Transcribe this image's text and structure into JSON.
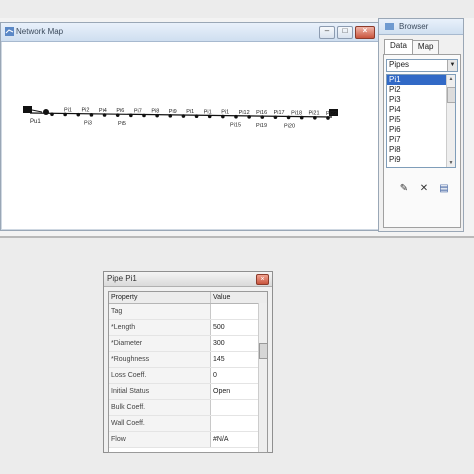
{
  "map_window": {
    "title": "Network Map",
    "buttons": {
      "minimize": "–",
      "maximize": "□",
      "close": "×"
    },
    "network": {
      "reservoir_label": "Pu1",
      "pipe_labels_top": [
        "Pi1",
        "Pi2",
        "Pi4",
        "Pi6",
        "Pi7",
        "Pi8",
        "Pi9",
        "Pi1",
        "Pi1",
        "Pi1",
        "Pi12",
        "Pi16",
        "Pi17",
        "Pi18",
        "Pi21",
        "Pi22"
      ],
      "pipe_labels_bottom": [
        "Pi3",
        "Pi5",
        "Pi15",
        "Pi19",
        "Pi20"
      ]
    }
  },
  "browser": {
    "title": "Browser",
    "tabs": [
      {
        "label": "Data"
      },
      {
        "label": "Map"
      }
    ],
    "select_value": "Pipes",
    "items": [
      "Pi1",
      "Pi2",
      "Pi3",
      "Pi4",
      "Pi5",
      "Pi6",
      "Pi7",
      "Pi8",
      "Pi9"
    ],
    "selected_index": 0,
    "tools": {
      "edit": "✎",
      "delete": "✕",
      "properties": "▤"
    }
  },
  "property_window": {
    "title": "Pipe Pi1",
    "close": "×",
    "headers": {
      "property": "Property",
      "value": "Value"
    },
    "rows": [
      {
        "property": "Tag",
        "value": ""
      },
      {
        "property": "*Length",
        "value": "500"
      },
      {
        "property": "*Diameter",
        "value": "300"
      },
      {
        "property": "*Roughness",
        "value": "145"
      },
      {
        "property": "Loss Coeff.",
        "value": "0"
      },
      {
        "property": "Initial Status",
        "value": "Open"
      },
      {
        "property": "Bulk Coeff.",
        "value": ""
      },
      {
        "property": "Wall Coeff.",
        "value": ""
      },
      {
        "property": "Flow",
        "value": "#N/A"
      }
    ]
  },
  "colors": {
    "selection": "#3169c6",
    "titlebar": "#cfdff0",
    "close": "#c9553e"
  }
}
